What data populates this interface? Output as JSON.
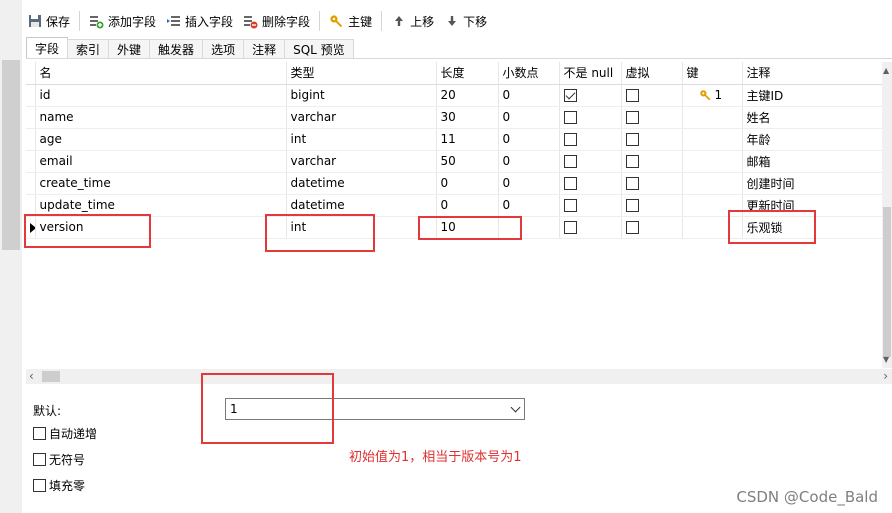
{
  "toolbar": {
    "save": "保存",
    "add_field": "添加字段",
    "insert_field": "插入字段",
    "delete_field": "删除字段",
    "primary_key": "主键",
    "move_up": "上移",
    "move_down": "下移"
  },
  "tabs": [
    "字段",
    "索引",
    "外键",
    "触发器",
    "选项",
    "注释",
    "SQL 预览"
  ],
  "active_tab": "字段",
  "grid": {
    "headers": {
      "name": "名",
      "type": "类型",
      "length": "长度",
      "decimals": "小数点",
      "not_null": "不是 null",
      "virtual": "虚拟",
      "key": "键",
      "comment": "注释"
    },
    "rows": [
      {
        "name": "id",
        "type": "bigint",
        "length": "20",
        "decimals": "0",
        "not_null": true,
        "virtual": false,
        "key": "1",
        "comment": "主键ID"
      },
      {
        "name": "name",
        "type": "varchar",
        "length": "30",
        "decimals": "0",
        "not_null": false,
        "virtual": false,
        "key": "",
        "comment": "姓名"
      },
      {
        "name": "age",
        "type": "int",
        "length": "11",
        "decimals": "0",
        "not_null": false,
        "virtual": false,
        "key": "",
        "comment": "年龄"
      },
      {
        "name": "email",
        "type": "varchar",
        "length": "50",
        "decimals": "0",
        "not_null": false,
        "virtual": false,
        "key": "",
        "comment": "邮箱"
      },
      {
        "name": "create_time",
        "type": "datetime",
        "length": "0",
        "decimals": "0",
        "not_null": false,
        "virtual": false,
        "key": "",
        "comment": "创建时间"
      },
      {
        "name": "update_time",
        "type": "datetime",
        "length": "0",
        "decimals": "0",
        "not_null": false,
        "virtual": false,
        "key": "",
        "comment": "更新时间"
      },
      {
        "name": "version",
        "type": "int",
        "length": "10",
        "decimals": "",
        "not_null": false,
        "virtual": false,
        "key": "",
        "comment": "乐观锁"
      }
    ]
  },
  "properties": {
    "default_label": "默认:",
    "default_value": "1",
    "auto_increment": "自动递增",
    "unsigned": "无符号",
    "zerofill": "填充零"
  },
  "annotation": "初始值为1，相当于版本号为1",
  "watermark": "CSDN @Code_Bald",
  "colors": {
    "annotation_red": "#e5383b",
    "key_gold": "#e0a000"
  }
}
